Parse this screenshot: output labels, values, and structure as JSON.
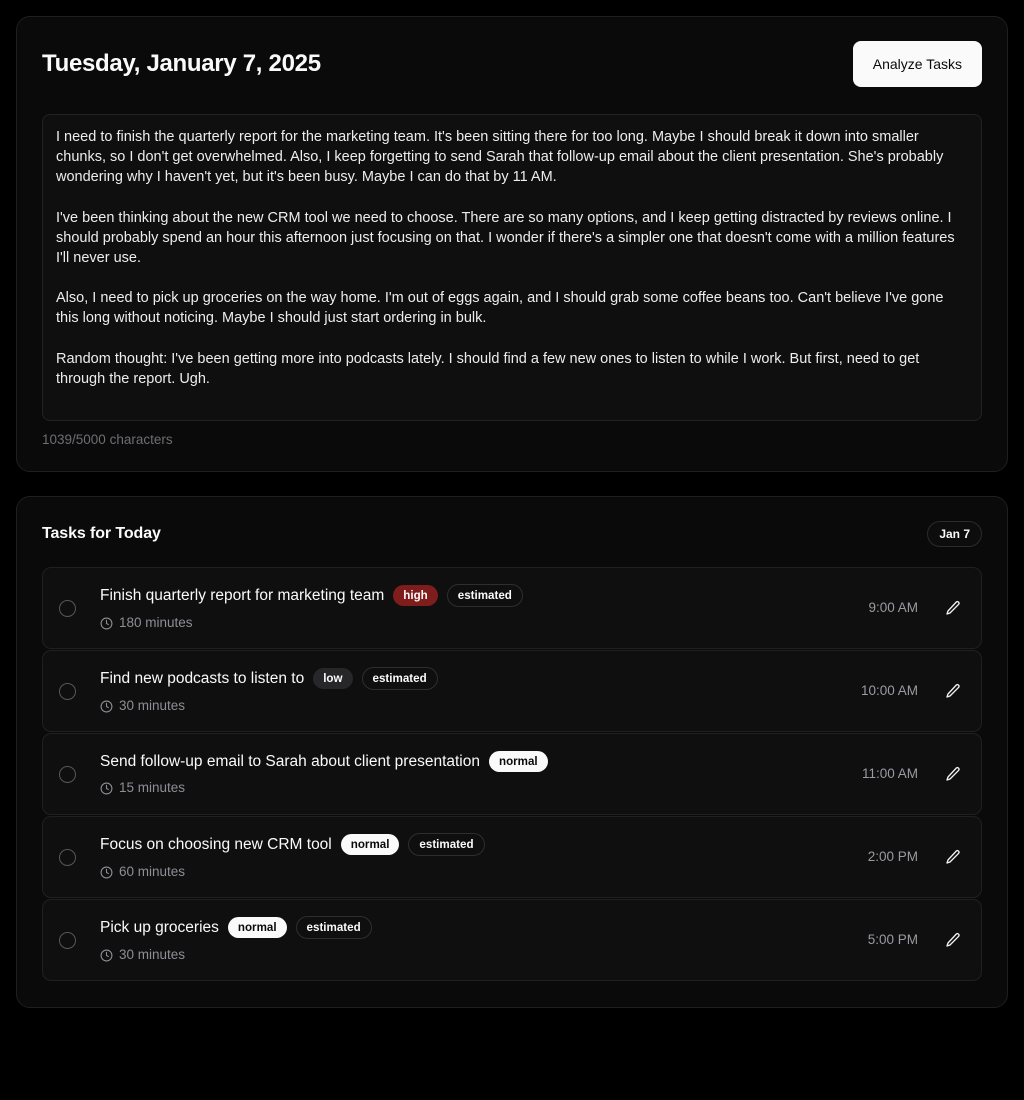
{
  "header": {
    "title": "Tuesday, January 7, 2025",
    "analyze_button": "Analyze Tasks"
  },
  "journal": {
    "paragraphs": [
      "I need to finish the quarterly report for the marketing team. It's been sitting there for too long. Maybe I should break it down into smaller chunks, so I don't get overwhelmed. Also, I keep forgetting to send Sarah that follow-up email about the client presentation. She's probably wondering why I haven't yet, but it's been busy. Maybe I can do that by 11 AM.",
      "I've been thinking about the new CRM tool we need to choose. There are so many options, and I keep getting distracted by reviews online. I should probably spend an hour this afternoon just focusing on that. I wonder if there's a simpler one that doesn't come with a million features I'll never use.",
      "Also, I need to pick up groceries on the way home. I'm out of eggs again, and I should grab some coffee beans too. Can't believe I've gone this long without noticing. Maybe I should just start ordering in bulk.",
      "Random thought: I've been getting more into podcasts lately. I should find a few new ones to listen to while I work. But first, need to get through the report. Ugh."
    ],
    "char_count_label": "1039/5000 characters"
  },
  "tasks_section": {
    "title": "Tasks for Today",
    "date_badge": "Jan 7",
    "tasks": [
      {
        "title": "Finish quarterly report for marketing team",
        "priority": "high",
        "priority_variant": "high",
        "estimated_label": "estimated",
        "duration": "180 minutes",
        "time": "9:00 AM",
        "checked": false
      },
      {
        "title": "Find new podcasts to listen to",
        "priority": "low",
        "priority_variant": "low",
        "estimated_label": "estimated",
        "duration": "30 minutes",
        "time": "10:00 AM",
        "checked": false
      },
      {
        "title": "Send follow-up email to Sarah about client presentation",
        "priority": "normal",
        "priority_variant": "normal",
        "estimated_label": "",
        "duration": "15 minutes",
        "time": "11:00 AM",
        "checked": false
      },
      {
        "title": "Focus on choosing new CRM tool",
        "priority": "normal",
        "priority_variant": "normal",
        "estimated_label": "estimated",
        "duration": "60 minutes",
        "time": "2:00 PM",
        "checked": false
      },
      {
        "title": "Pick up groceries",
        "priority": "normal",
        "priority_variant": "normal",
        "estimated_label": "estimated",
        "duration": "30 minutes",
        "time": "5:00 PM",
        "checked": false
      }
    ]
  },
  "colors": {
    "background": "#000000",
    "card": "#0a0a0a",
    "card_border": "#1f1f21",
    "inset": "#0f0f10",
    "text_primary": "#fafafa",
    "text_muted": "#8e8e94",
    "accent_white": "#fafafa",
    "priority_high": "#7f1d1d",
    "priority_low": "#27272a"
  }
}
